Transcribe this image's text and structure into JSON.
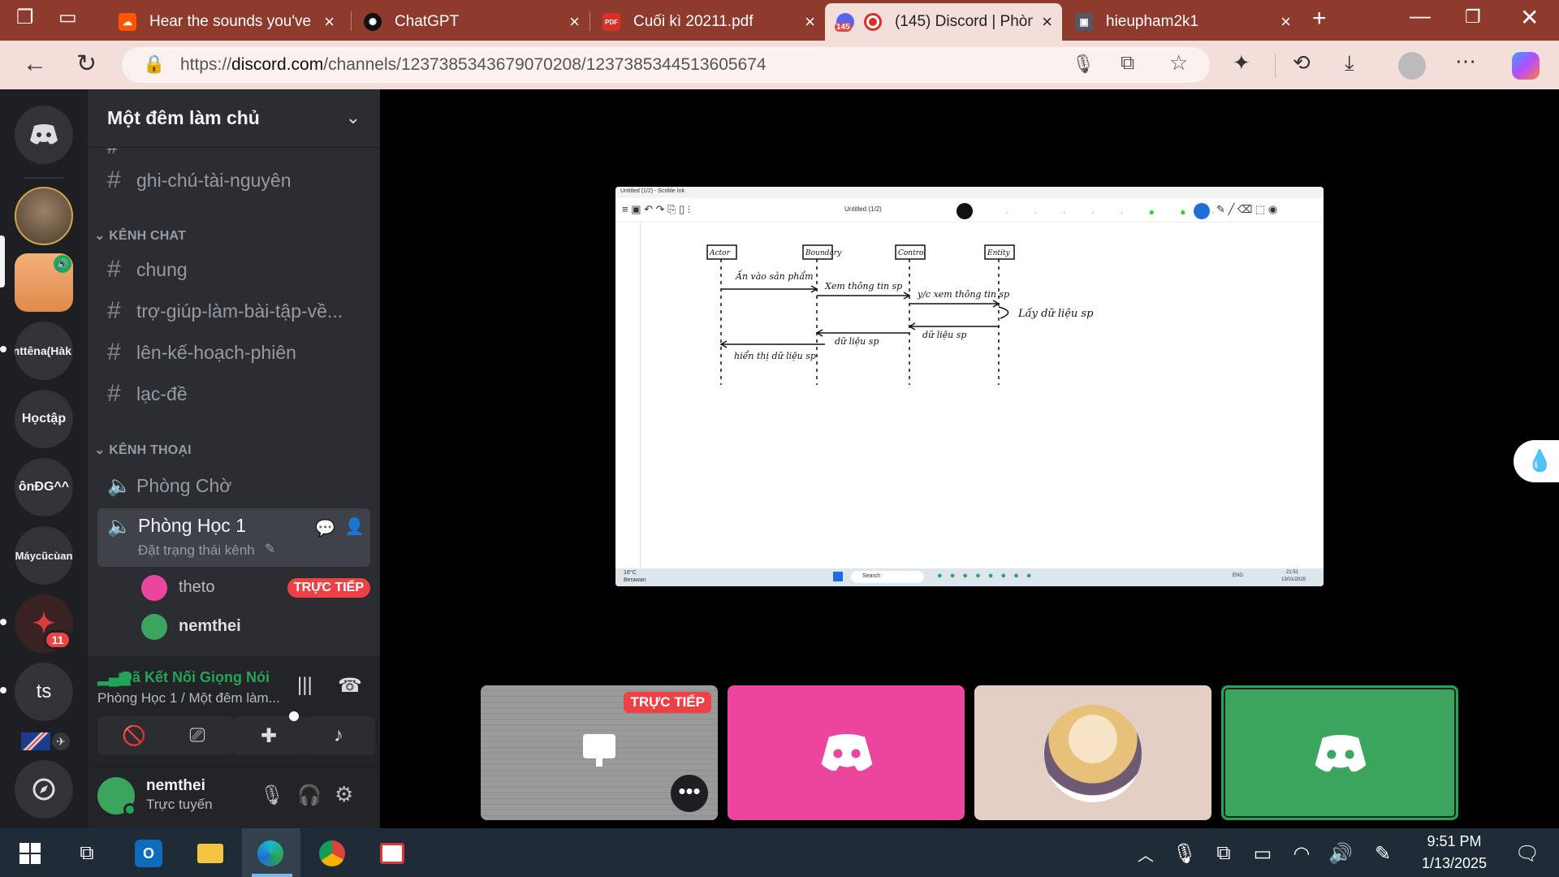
{
  "browser": {
    "tabs": [
      {
        "label": "Hear the sounds you've r",
        "icon": "soundcloud-icon",
        "color": "#ff5500"
      },
      {
        "label": "ChatGPT",
        "icon": "chatgpt-icon",
        "color": "#111111"
      },
      {
        "label": "Cuối kì 20211.pdf",
        "icon": "pdf-icon",
        "color": "#d93025"
      },
      {
        "label": "(145) Discord | Phòn",
        "icon": "discord-icon",
        "badge": "145",
        "active": true
      },
      {
        "label": "hieupham2k1",
        "icon": "image-icon"
      }
    ],
    "url_prefix": "https://",
    "url_host": "discord.com",
    "url_path": "/channels/1237385343679070208/1237385344513605674"
  },
  "servers": [
    {
      "label": "",
      "name": "discord-home"
    },
    {
      "label": "",
      "name": "server-avatar-1"
    },
    {
      "label": "",
      "name": "server-avatar-2"
    },
    {
      "label": "nttêna(Hàk",
      "name": "server-text-1"
    },
    {
      "label": "Họctập",
      "name": "server-hoctap"
    },
    {
      "label": "ônĐG^^",
      "name": "server-ondg"
    },
    {
      "label": "Máycũcùan",
      "name": "server-maycu"
    },
    {
      "label": "",
      "name": "server-avatar-3",
      "badge": "11"
    },
    {
      "label": "ts",
      "name": "server-ts"
    }
  ],
  "server": {
    "name": "Một đêm làm chủ",
    "channels_top": [
      "ghi-chú-tài-nguyên"
    ],
    "text_category": "KÊNH CHAT",
    "text_channels": [
      "chung",
      "trợ-giúp-làm-bài-tập-về...",
      "lên-kế-hoạch-phiên",
      "lạc-đề"
    ],
    "voice_category": "KÊNH THOẠI",
    "voice_channels": [
      "Phòng Chờ",
      "Phòng Học 1"
    ],
    "status_placeholder": "Đặt trạng thái kênh",
    "voice_members": [
      {
        "name": "theto",
        "live": "TRỰC TIẾP",
        "color": "#eb459e"
      },
      {
        "name": "nemthei",
        "color": "#3ba55d"
      }
    ]
  },
  "voice": {
    "connected": "Đã Kết Nối Giọng Nói",
    "location": "Phòng Học 1 / Một đêm làm..."
  },
  "user": {
    "name": "nemthei",
    "status": "Trực tuyến"
  },
  "stage": {
    "window_title": "Untitled (1/2) - Scrible Ink",
    "doc_title": "Untitled (1/2)",
    "live_label": "TRỰC TIẾP",
    "diagram": {
      "lifelines": [
        "Actor",
        "Boundary",
        "Control",
        "Entity"
      ],
      "messages": [
        "Ấn vào sản phẩm",
        "Xem thông tin sp",
        "y/c xem thông tin sp",
        "Lấy dữ liệu sp",
        "dữ liệu sp",
        "dữ liệu sp",
        "hiển thị dữ liệu sp"
      ]
    },
    "inner_taskbar": {
      "temp": "16°C",
      "weather": "Berawan",
      "search": "Search",
      "lang": "ENG",
      "time": "21:51",
      "date": "13/01/2025"
    }
  },
  "taskbar": {
    "time": "9:51 PM",
    "date": "1/13/2025"
  },
  "colors": {
    "discord_blurple": "#5865f2",
    "pink_tile": "#eb459e",
    "green_tile": "#3ba55d",
    "live_red": "#ed4245",
    "tan_tile": "#e4cfc5"
  }
}
